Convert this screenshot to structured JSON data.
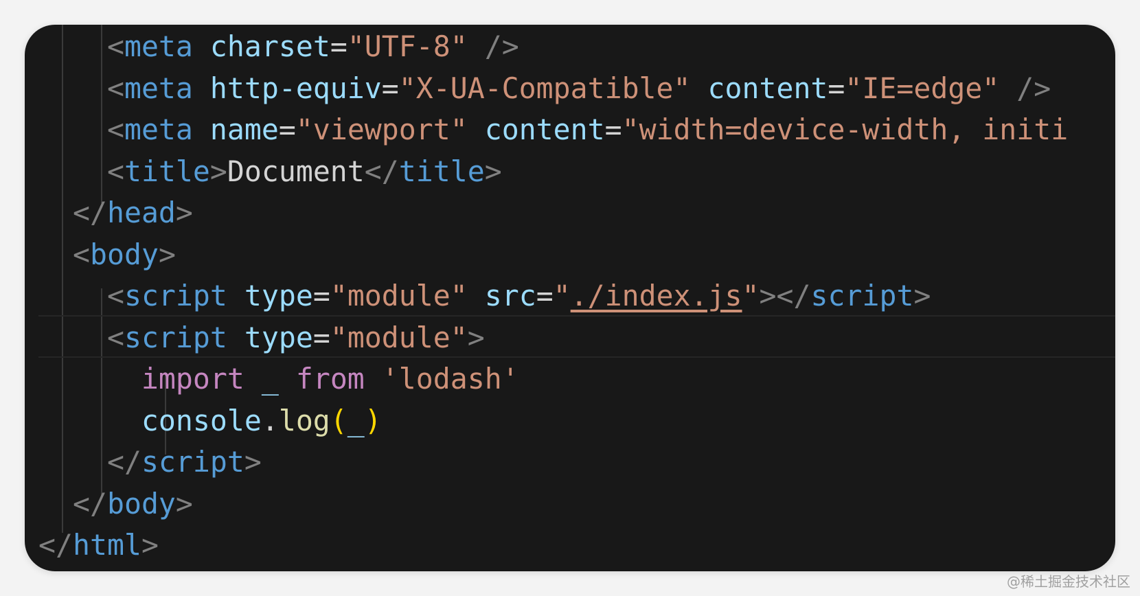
{
  "editor": {
    "theme_colors": {
      "background": "#181818",
      "bracket": "#808080",
      "tag": "#569cd6",
      "attribute": "#9cdcfe",
      "string": "#ce9178",
      "keyword": "#c586c0",
      "function": "#dcdcaa",
      "paren": "#ffd700"
    },
    "lines": [
      {
        "indent": "    ",
        "tokens": [
          {
            "t": "br",
            "v": "<"
          },
          {
            "t": "tag",
            "v": "meta"
          },
          {
            "t": "txt",
            "v": " "
          },
          {
            "t": "attr",
            "v": "charset"
          },
          {
            "t": "txt",
            "v": "="
          },
          {
            "t": "str",
            "v": "\"UTF-8\""
          },
          {
            "t": "txt",
            "v": " "
          },
          {
            "t": "br",
            "v": "/>"
          }
        ]
      },
      {
        "indent": "    ",
        "tokens": [
          {
            "t": "br",
            "v": "<"
          },
          {
            "t": "tag",
            "v": "meta"
          },
          {
            "t": "txt",
            "v": " "
          },
          {
            "t": "attr",
            "v": "http-equiv"
          },
          {
            "t": "txt",
            "v": "="
          },
          {
            "t": "str",
            "v": "\"X-UA-Compatible\""
          },
          {
            "t": "txt",
            "v": " "
          },
          {
            "t": "attr",
            "v": "content"
          },
          {
            "t": "txt",
            "v": "="
          },
          {
            "t": "str",
            "v": "\"IE=edge\""
          },
          {
            "t": "txt",
            "v": " "
          },
          {
            "t": "br",
            "v": "/>"
          }
        ]
      },
      {
        "indent": "    ",
        "tokens": [
          {
            "t": "br",
            "v": "<"
          },
          {
            "t": "tag",
            "v": "meta"
          },
          {
            "t": "txt",
            "v": " "
          },
          {
            "t": "attr",
            "v": "name"
          },
          {
            "t": "txt",
            "v": "="
          },
          {
            "t": "str",
            "v": "\"viewport\""
          },
          {
            "t": "txt",
            "v": " "
          },
          {
            "t": "attr",
            "v": "content"
          },
          {
            "t": "txt",
            "v": "="
          },
          {
            "t": "str",
            "v": "\"width=device-width, initi"
          }
        ]
      },
      {
        "indent": "    ",
        "tokens": [
          {
            "t": "br",
            "v": "<"
          },
          {
            "t": "tag",
            "v": "title"
          },
          {
            "t": "br",
            "v": ">"
          },
          {
            "t": "txt",
            "v": "Document"
          },
          {
            "t": "br",
            "v": "</"
          },
          {
            "t": "tag",
            "v": "title"
          },
          {
            "t": "br",
            "v": ">"
          }
        ]
      },
      {
        "indent": "  ",
        "tokens": [
          {
            "t": "br",
            "v": "</"
          },
          {
            "t": "tag",
            "v": "head"
          },
          {
            "t": "br",
            "v": ">"
          }
        ]
      },
      {
        "indent": "  ",
        "tokens": [
          {
            "t": "br",
            "v": "<"
          },
          {
            "t": "tag",
            "v": "body"
          },
          {
            "t": "br",
            "v": ">"
          }
        ]
      },
      {
        "indent": "    ",
        "tokens": [
          {
            "t": "br",
            "v": "<"
          },
          {
            "t": "tag",
            "v": "script"
          },
          {
            "t": "txt",
            "v": " "
          },
          {
            "t": "attr",
            "v": "type"
          },
          {
            "t": "txt",
            "v": "="
          },
          {
            "t": "str",
            "v": "\"module\""
          },
          {
            "t": "txt",
            "v": " "
          },
          {
            "t": "attr",
            "v": "src"
          },
          {
            "t": "txt",
            "v": "="
          },
          {
            "t": "str",
            "v": "\""
          },
          {
            "t": "link",
            "v": "./index.js"
          },
          {
            "t": "str",
            "v": "\""
          },
          {
            "t": "br",
            "v": "></"
          },
          {
            "t": "tag",
            "v": "script"
          },
          {
            "t": "br",
            "v": ">"
          }
        ]
      },
      {
        "indent": "    ",
        "current": true,
        "tokens": [
          {
            "t": "br",
            "v": "<"
          },
          {
            "t": "tag",
            "v": "script"
          },
          {
            "t": "txt",
            "v": " "
          },
          {
            "t": "attr",
            "v": "type"
          },
          {
            "t": "txt",
            "v": "="
          },
          {
            "t": "str",
            "v": "\"module\""
          },
          {
            "t": "br",
            "v": ">"
          }
        ]
      },
      {
        "indent": "      ",
        "tokens": [
          {
            "t": "kw",
            "v": "import"
          },
          {
            "t": "txt",
            "v": " "
          },
          {
            "t": "var",
            "v": "_"
          },
          {
            "t": "txt",
            "v": " "
          },
          {
            "t": "kw",
            "v": "from"
          },
          {
            "t": "txt",
            "v": " "
          },
          {
            "t": "str",
            "v": "'lodash'"
          }
        ]
      },
      {
        "indent": "      ",
        "tokens": [
          {
            "t": "var",
            "v": "console"
          },
          {
            "t": "txt",
            "v": "."
          },
          {
            "t": "fn",
            "v": "log"
          },
          {
            "t": "par",
            "v": "("
          },
          {
            "t": "var",
            "v": "_"
          },
          {
            "t": "par",
            "v": ")"
          }
        ]
      },
      {
        "indent": "    ",
        "tokens": [
          {
            "t": "br",
            "v": "</"
          },
          {
            "t": "tag",
            "v": "script"
          },
          {
            "t": "br",
            "v": ">"
          }
        ]
      },
      {
        "indent": "  ",
        "tokens": [
          {
            "t": "br",
            "v": "</"
          },
          {
            "t": "tag",
            "v": "body"
          },
          {
            "t": "br",
            "v": ">"
          }
        ]
      },
      {
        "indent": "",
        "tokens": [
          {
            "t": "br",
            "v": "</"
          },
          {
            "t": "tag",
            "v": "html"
          },
          {
            "t": "br",
            "v": ">"
          }
        ]
      }
    ]
  },
  "watermark": "@稀土掘金技术社区"
}
